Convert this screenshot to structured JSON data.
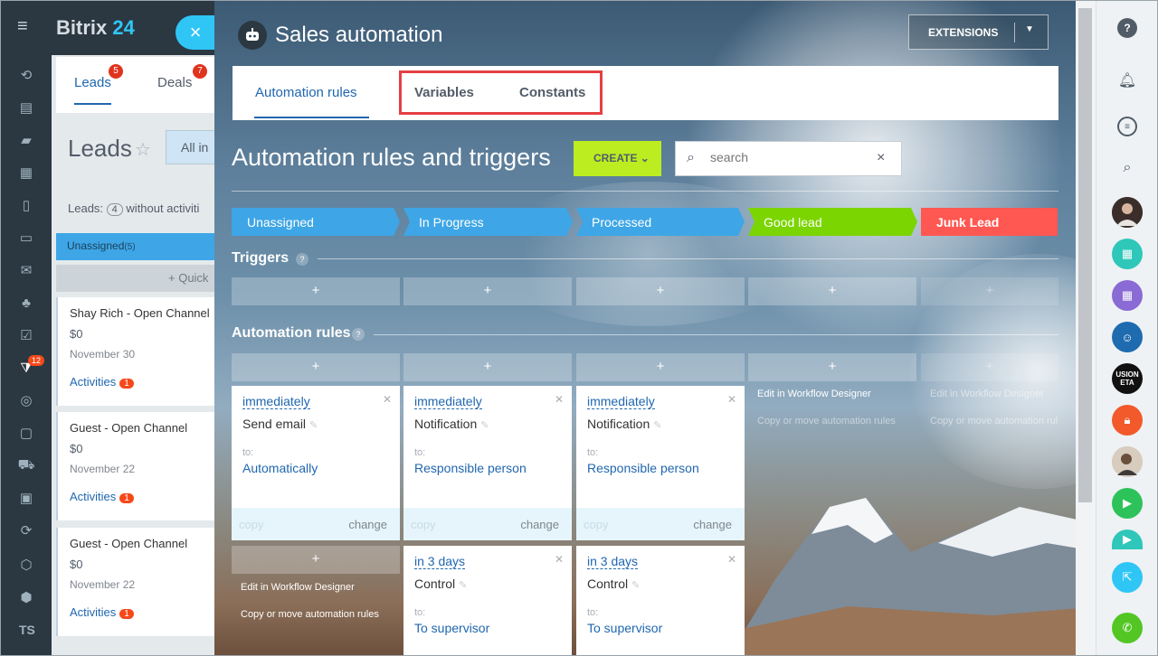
{
  "leftnav": {
    "badge": "12",
    "user_initials": "TS"
  },
  "crm": {
    "brand_name": "Bitrix",
    "brand_number": "24",
    "close_icon": "×",
    "tabs": [
      {
        "label": "Leads",
        "badge": "5"
      },
      {
        "label": "Deals",
        "badge": "7"
      }
    ],
    "page_title": "Leads",
    "filter_label": "All in",
    "leads_count_prefix": "Leads:",
    "leads_count_value": "4",
    "leads_count_suffix": "without activiti",
    "column_title": "Unassigned",
    "column_count": "(5)",
    "quick_label": "+ Quick",
    "cards": [
      {
        "name": "Shay Rich - Open Channel",
        "amount": "$0",
        "date": "November 30",
        "activities_label": "Activities",
        "activities_count": "1"
      },
      {
        "name": "Guest - Open Channel",
        "amount": "$0",
        "date": "November 22",
        "activities_label": "Activities",
        "activities_count": "1"
      },
      {
        "name": "Guest - Open Channel",
        "amount": "$0",
        "date": "November 22",
        "activities_label": "Activities",
        "activities_count": "1"
      }
    ]
  },
  "slider": {
    "title": "Sales automation",
    "extensions_label": "EXTENSIONS",
    "tabs": [
      "Automation rules",
      "Variables",
      "Constants"
    ],
    "heading": "Automation rules and triggers",
    "create_label": "CREATE",
    "search_placeholder": "search",
    "stages": [
      {
        "label": "Unassigned",
        "color": "#3ea6e6"
      },
      {
        "label": "In Progress",
        "color": "#3ea6e6"
      },
      {
        "label": "Processed",
        "color": "#3ea6e6"
      },
      {
        "label": "Good lead",
        "color": "#7bd500"
      },
      {
        "label": "Junk Lead",
        "color": "#ff5752"
      }
    ],
    "triggers_title": "Triggers",
    "rules_title": "Automation rules",
    "help_mark": "?",
    "plus": "+",
    "edit_designer": "Edit in Workflow Designer",
    "copy_move": "Copy or move automation rules",
    "copy_move_cut": "Copy or move automation rul",
    "rules": [
      {
        "when": "immediately",
        "action": "Send email",
        "to_label": "to:",
        "target": "Automatically",
        "copy": "copy",
        "change": "change"
      },
      {
        "when": "immediately",
        "action": "Notification",
        "to_label": "to:",
        "target": "Responsible person",
        "copy": "copy",
        "change": "change"
      },
      {
        "when": "immediately",
        "action": "Notification",
        "to_label": "to:",
        "target": "Responsible person",
        "copy": "copy",
        "change": "change"
      },
      {
        "when": "in 3 days",
        "action": "Control",
        "to_label": "to:",
        "target": "To supervisor"
      },
      {
        "when": "in 3 days",
        "action": "Control",
        "to_label": "to:",
        "target": "To supervisor"
      }
    ]
  },
  "rightbar": {
    "help_icon": "?",
    "avatar_text": "USION ETA"
  }
}
